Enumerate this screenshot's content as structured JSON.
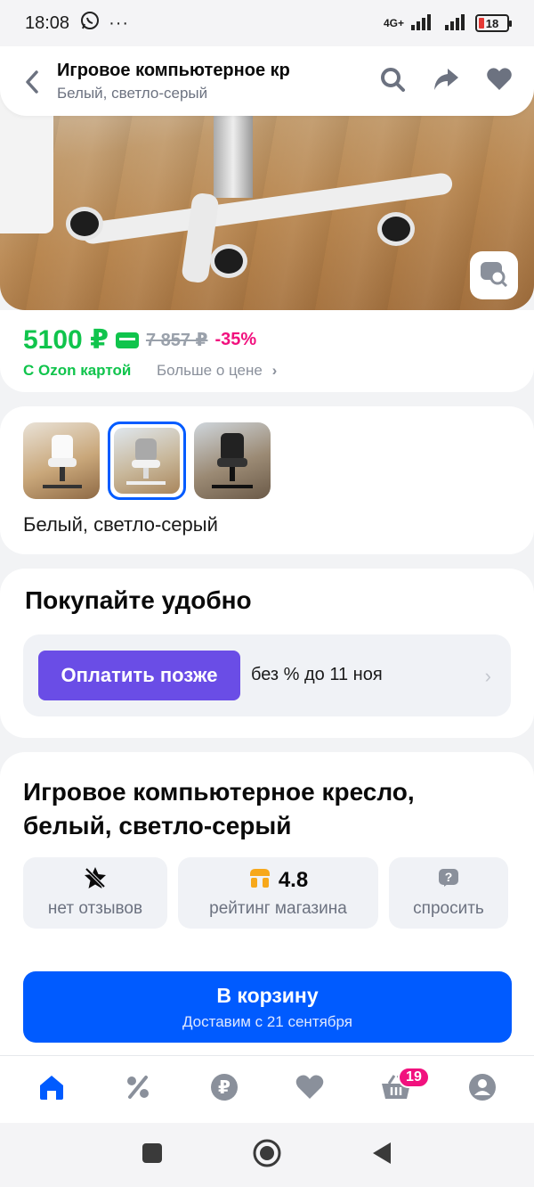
{
  "status_bar": {
    "time": "18:08",
    "left_icons": [
      "whatsapp-icon",
      "more-dots-icon"
    ],
    "network": "4G+",
    "battery": "18"
  },
  "header": {
    "title": "Игровое компьютерное кр",
    "subtitle": "Белый, светло-серый",
    "icons": [
      "back-arrow-icon",
      "search-icon",
      "share-icon",
      "heart-icon"
    ]
  },
  "price": {
    "current": "5100 ₽",
    "old": "7 857 ₽",
    "discount": "-35%",
    "ozon_card_label": "С Ozon картой",
    "more_label": "Больше о цене",
    "accent_color": "#10c44c",
    "discount_color": "#f1117e"
  },
  "variants": {
    "selected_label": "Белый, светло-серый",
    "thumbnails": [
      "chair-white-black",
      "chair-white-grey",
      "chair-black"
    ],
    "selected_index": 1
  },
  "buy": {
    "title": "Покупайте удобно",
    "pay_later_button": "Оплатить позже",
    "pay_later_text": "без % до 11 ноя",
    "pay_color": "#6a4de6"
  },
  "product": {
    "title": "Игровое компьютерное кресло, белый, светло-серый",
    "reviews_label": "нет отзывов",
    "store_rating": "4.8",
    "store_rating_label": "рейтинг магазина",
    "ask_label": "спросить"
  },
  "cart": {
    "button_label": "В корзину",
    "delivery_text": "Доставим с 21 сентября",
    "button_color": "#005bff"
  },
  "bottom_nav": {
    "items": [
      "home-icon",
      "discount-icon",
      "ruble-icon",
      "favorites-icon",
      "cart-icon",
      "profile-icon"
    ],
    "cart_badge": "19",
    "active_index": 0
  },
  "system_nav": [
    "recent-apps-icon",
    "home-circle-icon",
    "back-triangle-icon"
  ]
}
